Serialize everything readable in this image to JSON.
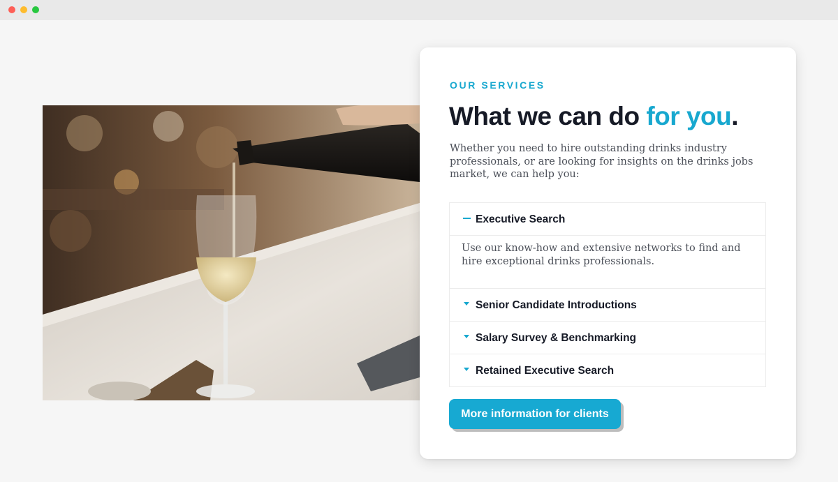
{
  "window": {
    "controls": [
      "close",
      "minimize",
      "maximize"
    ]
  },
  "colors": {
    "accent": "#18a8cf",
    "heading": "#161a26",
    "button": "#17a9d2"
  },
  "hero_image": {
    "subject": "wine-pouring-photo"
  },
  "services": {
    "eyebrow": "OUR SERVICES",
    "headline_main": "What we can do ",
    "headline_accent": "for you",
    "headline_end": ".",
    "intro": "Whether you need to hire outstanding drinks industry professionals, or are looking for insights on the drinks jobs market, we can help you:",
    "accordion": [
      {
        "title": "Executive Search",
        "expanded": true,
        "icon": "minus-icon",
        "body": "Use our know-how and extensive networks to find and hire exceptional drinks professionals."
      },
      {
        "title": "Senior Candidate Introductions",
        "expanded": false,
        "icon": "caret-down-icon"
      },
      {
        "title": "Salary Survey & Benchmarking",
        "expanded": false,
        "icon": "caret-down-icon"
      },
      {
        "title": "Retained Executive Search",
        "expanded": false,
        "icon": "caret-down-icon"
      }
    ],
    "cta_label": "More information for clients"
  }
}
